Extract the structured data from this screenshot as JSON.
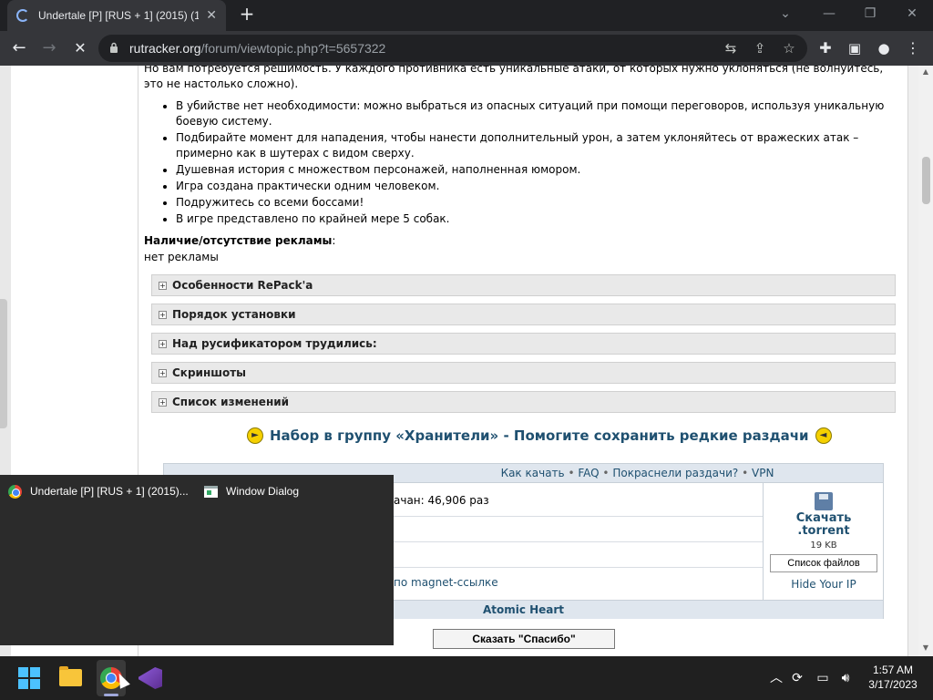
{
  "browser": {
    "tab_title": "Undertale [P] [RUS + 1] (2015) (1",
    "new_tab": "+",
    "url_host": "rutracker.org",
    "url_path": "/forum/viewtopic.php?t=5657322"
  },
  "post": {
    "intro": "Но вам потребуется решимость. У каждого противника есть уникальные атаки, от которых нужно уклоняться (не волнуйтесь, это не настолько сложно).",
    "bullets": [
      "В убийстве нет необходимости: можно выбраться из опасных ситуаций при помощи переговоров, используя уникальную боевую систему.",
      "Подбирайте момент для нападения, чтобы нанести дополнительный урон, а затем уклоняйтесь от вражеских атак – примерно как в шутерах с видом сверху.",
      "Душевная история с множеством персонажей, наполненная юмором.",
      "Игра создана практически одним человеком.",
      "Подружитесь со всеми боссами!",
      "В игре представлено по крайней мере 5 собак."
    ],
    "ads_label": "Наличие/отсутствие рекламы",
    "ads_colon": ":",
    "ads_value": "нет рекламы",
    "spoilers": [
      "Особенности RePack'a",
      "Порядок установки",
      "Над русификатором трудились:",
      "Скриншоты",
      "Список изменений"
    ],
    "keeper_banner": "Набор в группу «Хранители» - Помогите сохранить редкие раздачи"
  },
  "download": {
    "head_links": [
      "Как качать",
      "FAQ",
      "Покраснели раздачи?",
      "VPN"
    ],
    "head_sep": "•",
    "downloads_text": "ачан: 46,906 раз",
    "magnet_text": "по magnet-ссылке",
    "torrent_link_1": "Скачать",
    "torrent_link_2": ".torrent",
    "torrent_size": "19 KB",
    "files_button": "Список файлов",
    "hide_ip": "Hide Your IP",
    "footer": "Atomic Heart"
  },
  "thanks_button": "Сказать \"Спасибо\"",
  "popup": {
    "items": [
      "Undertale [P] [RUS + 1] (2015)...",
      "Window Dialog"
    ]
  },
  "taskbar": {
    "time": "1:57 AM",
    "date": "3/17/2023"
  },
  "colors": {
    "link": "#1f5070",
    "chrome_dark": "#202124",
    "taskbar": "#202020"
  }
}
